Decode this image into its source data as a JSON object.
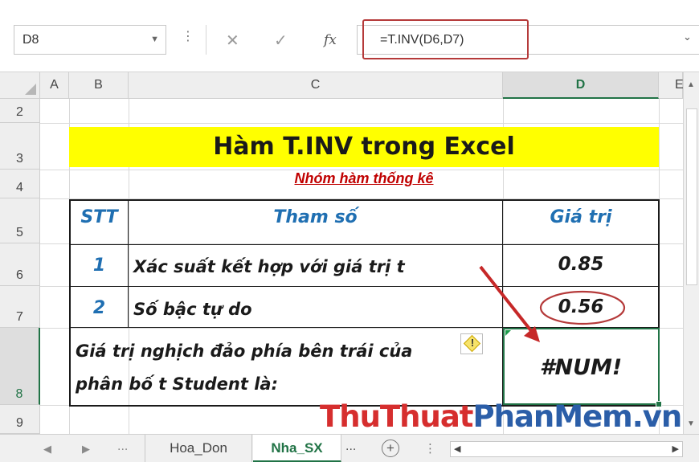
{
  "formula_bar": {
    "name_box": "D8",
    "dots": "⋮",
    "cancel_icon": "✕",
    "enter_icon": "✓",
    "fx_label": "fx",
    "formula": "=T.INV(D6,D7)",
    "expand_icon": "⌄"
  },
  "columns": [
    "A",
    "B",
    "C",
    "D",
    "E"
  ],
  "rows": [
    "2",
    "3",
    "4",
    "5",
    "6",
    "7",
    "8",
    "9"
  ],
  "sheet": {
    "title": "Hàm T.INV trong Excel",
    "subtitle": "Nhóm hàm thống kê",
    "header": {
      "stt": "STT",
      "param": "Tham số",
      "value": "Giá trị"
    },
    "rows": [
      {
        "stt": "1",
        "param": "Xác suất kết hợp với giá trị t",
        "value": "0.85"
      },
      {
        "stt": "2",
        "param": "Số bậc tự do",
        "value": "0.56"
      }
    ],
    "result_label_line1": "Giá trị nghịch đảo phía bên trái của",
    "result_label_line2": "phân bố t Student là:",
    "result_value": "#NUM!",
    "warning_icon": "!"
  },
  "tabs": {
    "nav_prev": "◀",
    "nav_next": "▶",
    "nav_more": "...",
    "items": [
      "Hoa_Don",
      "Nha_SX"
    ],
    "active": "Nha_SX",
    "overflow": "...",
    "add": "+",
    "dots": "⋮"
  },
  "watermark": {
    "part1": "ThuThuat",
    "part2": "PhanMem.vn"
  },
  "colors": {
    "excel_green": "#217346",
    "highlight_red": "#b53a3a",
    "title_yellow": "#ffff00",
    "label_blue": "#1f6fb2"
  }
}
